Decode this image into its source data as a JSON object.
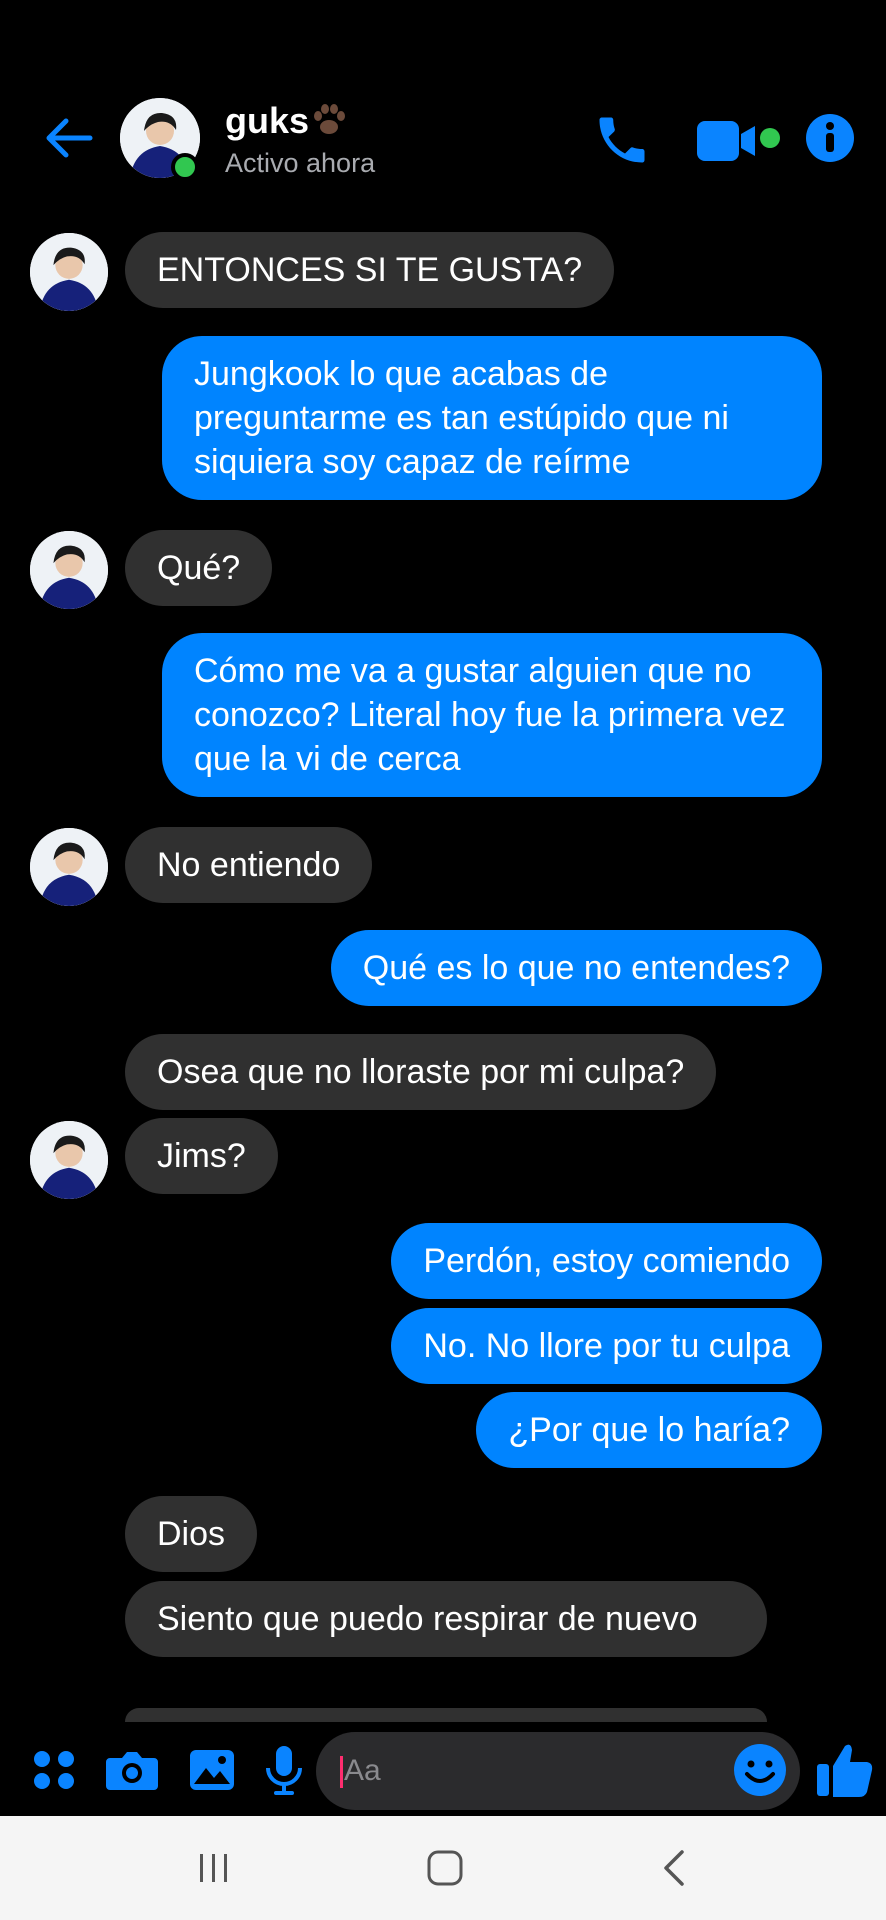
{
  "contact": {
    "name": "guks",
    "status": "Activo ahora"
  },
  "messages": [
    {
      "text": "ENTONCES SI TE GUSTA?"
    },
    {
      "text": "Jungkook lo que acabas de preguntarme es tan estúpido que ni siquiera soy capaz de reírme"
    },
    {
      "text": "Qué?"
    },
    {
      "text": "Cómo me va a gustar alguien que no conozco? Literal hoy fue la primera vez que la vi de cerca"
    },
    {
      "text": "No entiendo"
    },
    {
      "text": "Qué es lo que no entendes?"
    },
    {
      "text": "Osea que no lloraste por mi culpa?"
    },
    {
      "text": "Jims?"
    },
    {
      "text": "Perdón, estoy comiendo"
    },
    {
      "text": "No. No llore por tu culpa"
    },
    {
      "text": "¿Por que lo haría?"
    },
    {
      "text": "Dios"
    },
    {
      "text": "Siento que puedo respirar de nuevo"
    }
  ],
  "composer": {
    "placeholder": "Aa"
  },
  "colors": {
    "accent": "#0084ff",
    "incoming_bubble": "#303030",
    "online": "#31c750",
    "background": "#000000"
  },
  "icons": [
    "back-arrow-icon",
    "paw-icon",
    "phone-icon",
    "video-camera-icon",
    "info-icon",
    "apps-icon",
    "camera-icon",
    "image-icon",
    "microphone-icon",
    "smiley-icon",
    "thumbs-up-icon"
  ]
}
